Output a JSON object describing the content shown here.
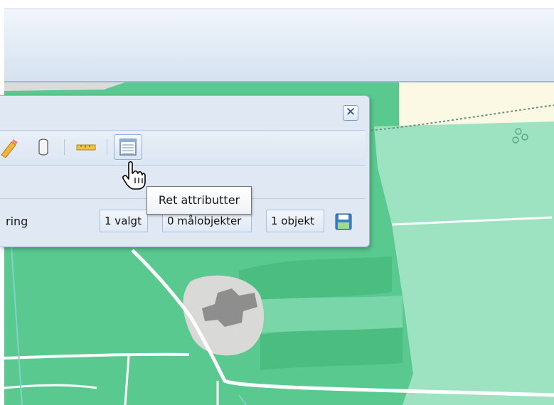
{
  "panel": {
    "close_symbol": "✕",
    "status_label": "ring",
    "selected_count": "1 valgt",
    "target_objects": "0 målobjekter",
    "object_count": "1 objekt"
  },
  "toolbar": {
    "icons": [
      "pencil-icon",
      "cylinder-icon",
      "ruler-icon",
      "attribute-table-icon"
    ]
  },
  "tooltip": {
    "text": "Ret attributter"
  },
  "colors": {
    "map_green": "#5ac98f",
    "map_light_green": "#9de3c2",
    "map_cream": "#fbf8e3",
    "panel_bg": "#dfe8f3",
    "header_bg": "#dce6f2"
  }
}
